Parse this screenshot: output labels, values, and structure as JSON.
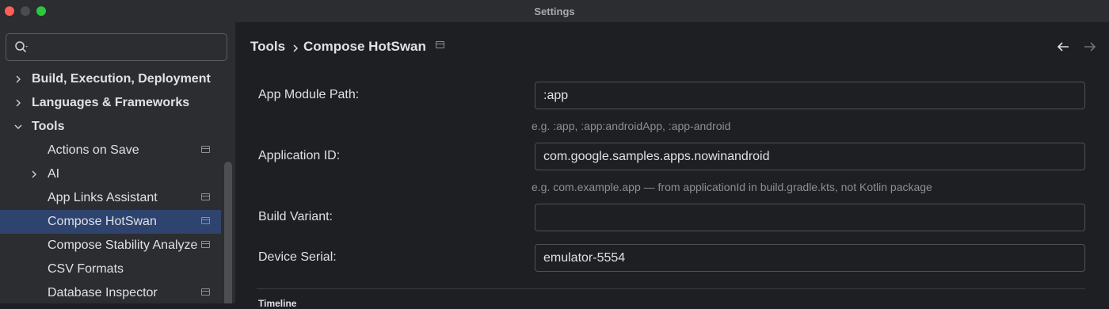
{
  "window": {
    "title": "Settings"
  },
  "sidebar": {
    "search": {
      "value": "",
      "placeholder": ""
    },
    "items": [
      {
        "label": "Build, Execution, Deployment"
      },
      {
        "label": "Languages & Frameworks"
      },
      {
        "label": "Tools"
      },
      {
        "label": "Actions on Save"
      },
      {
        "label": "AI"
      },
      {
        "label": "App Links Assistant"
      },
      {
        "label": "Compose HotSwan"
      },
      {
        "label": "Compose Stability Analyzer"
      },
      {
        "label": "CSV Formats"
      },
      {
        "label": "Database Inspector"
      }
    ]
  },
  "breadcrumb": {
    "parent": "Tools",
    "current": "Compose HotSwan"
  },
  "form": {
    "app_module_path": {
      "label": "App Module Path:",
      "value": ":app",
      "hint": "e.g. :app, :app:androidApp, :app-android"
    },
    "application_id": {
      "label": "Application ID:",
      "value": "com.google.samples.apps.nowinandroid",
      "hint": "e.g. com.example.app — from applicationId in build.gradle.kts, not Kotlin package"
    },
    "build_variant": {
      "label": "Build Variant:",
      "value": ""
    },
    "device_serial": {
      "label": "Device Serial:",
      "value": "emulator-5554"
    }
  },
  "section": {
    "title": "Timeline"
  },
  "colors": {
    "accent_selection": "#2e436e",
    "close": "#fe5f57",
    "zoom": "#2ac840",
    "sidebar_bg": "#2b2d30",
    "content_bg": "#1e1f22"
  }
}
